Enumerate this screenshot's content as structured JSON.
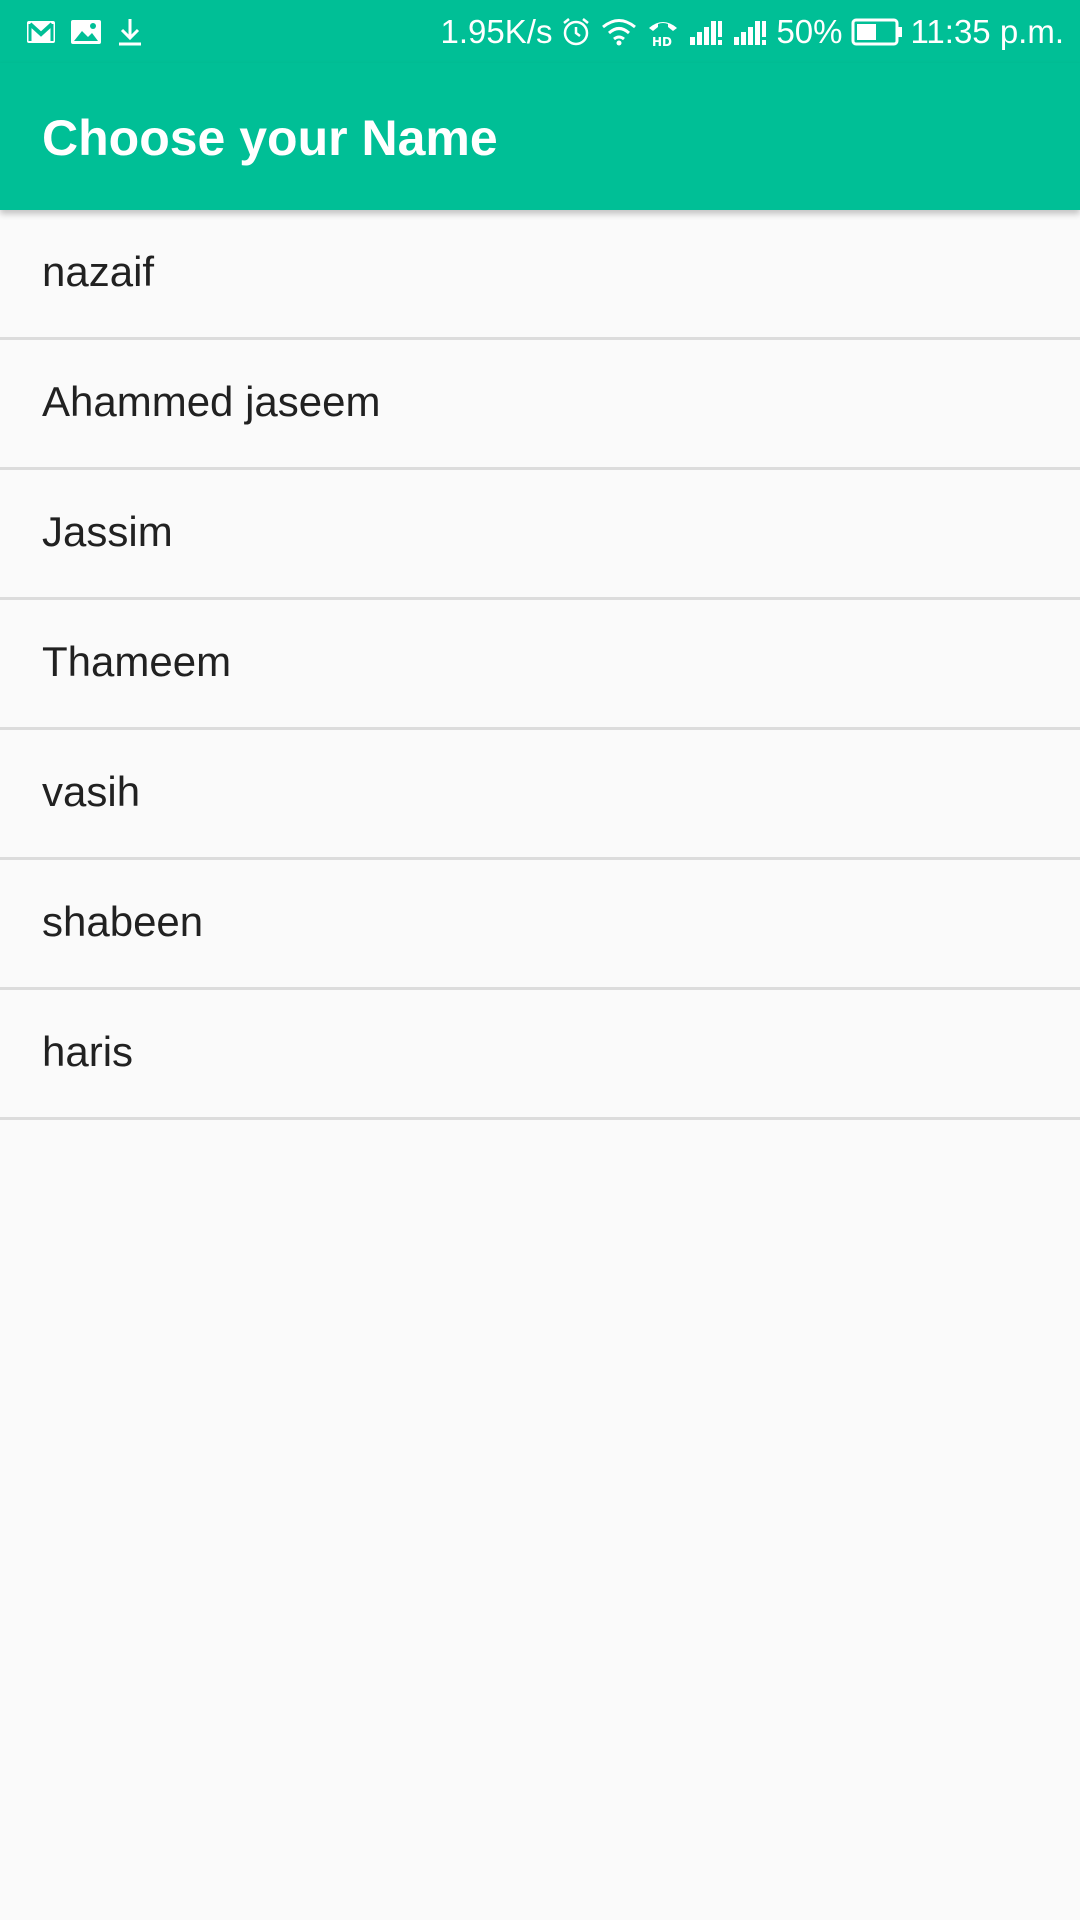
{
  "status_bar": {
    "icons_left": [
      "gmail-icon",
      "image-icon",
      "download-icon"
    ],
    "network_speed": "1.95K/s",
    "icons_right": [
      "alarm-icon",
      "wifi-icon",
      "hd-call-icon",
      "signal-icon",
      "signal-icon"
    ],
    "battery_percent": "50%",
    "time": "11:35 p.m."
  },
  "app_bar": {
    "title": "Choose your Name",
    "background_color": "#00bf96"
  },
  "names": [
    {
      "label": "nazaif"
    },
    {
      "label": "Ahammed jaseem"
    },
    {
      "label": "Jassim"
    },
    {
      "label": "Thameem"
    },
    {
      "label": "vasih"
    },
    {
      "label": "shabeen"
    },
    {
      "label": "haris"
    }
  ]
}
